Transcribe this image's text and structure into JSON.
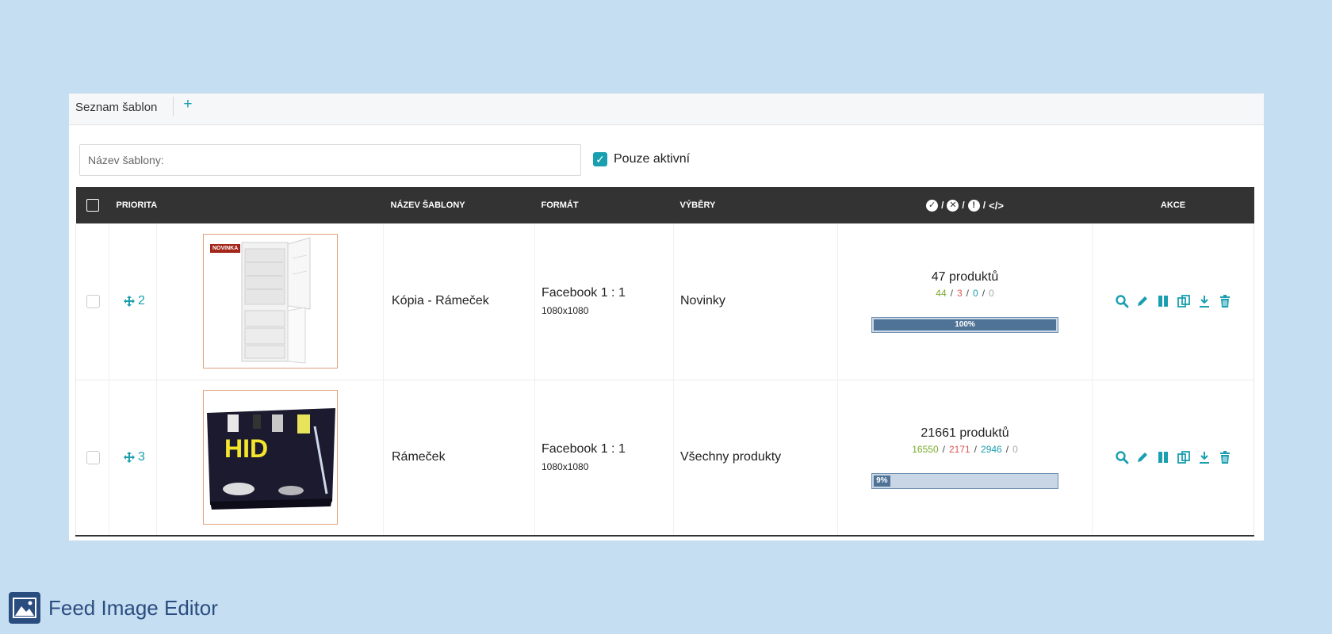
{
  "tabs": {
    "list_label": "Seznam šablon",
    "add_label": "+"
  },
  "filters": {
    "name_placeholder": "Název šablony:",
    "name_value": "",
    "active_only_label": "Pouze aktivní",
    "active_only_checked": true
  },
  "table": {
    "headers": {
      "priority": "PRIORITA",
      "name": "NÁZEV ŠABLONY",
      "format": "FORMÁT",
      "selection": "VÝBĚRY",
      "stats_sep": "/",
      "actions": "AKCE"
    },
    "rows": [
      {
        "priority": "2",
        "image_badge": "NOVINKA",
        "name": "Kópia - Rámeček",
        "format_title": "Facebook 1 : 1",
        "format_size": "1080x1080",
        "selection": "Novinky",
        "total": "47 produktů",
        "ok": "44",
        "err": "3",
        "warn": "0",
        "code": "0",
        "progress_pct": 100,
        "progress_label": "100%"
      },
      {
        "priority": "3",
        "image_text": "HID",
        "name": "Rámeček",
        "format_title": "Facebook 1 : 1",
        "format_size": "1080x1080",
        "selection": "Všechny produkty",
        "total": "21661 produktů",
        "ok": "16550",
        "err": "2171",
        "warn": "2946",
        "code": "0",
        "progress_pct": 9,
        "progress_label": "9%"
      }
    ]
  },
  "brand": {
    "name": "Feed Image Editor"
  },
  "colors": {
    "accent": "#1a9fb0",
    "header_bg": "#333333",
    "page_bg": "#c6def1",
    "progress_fill": "#4f7396"
  }
}
